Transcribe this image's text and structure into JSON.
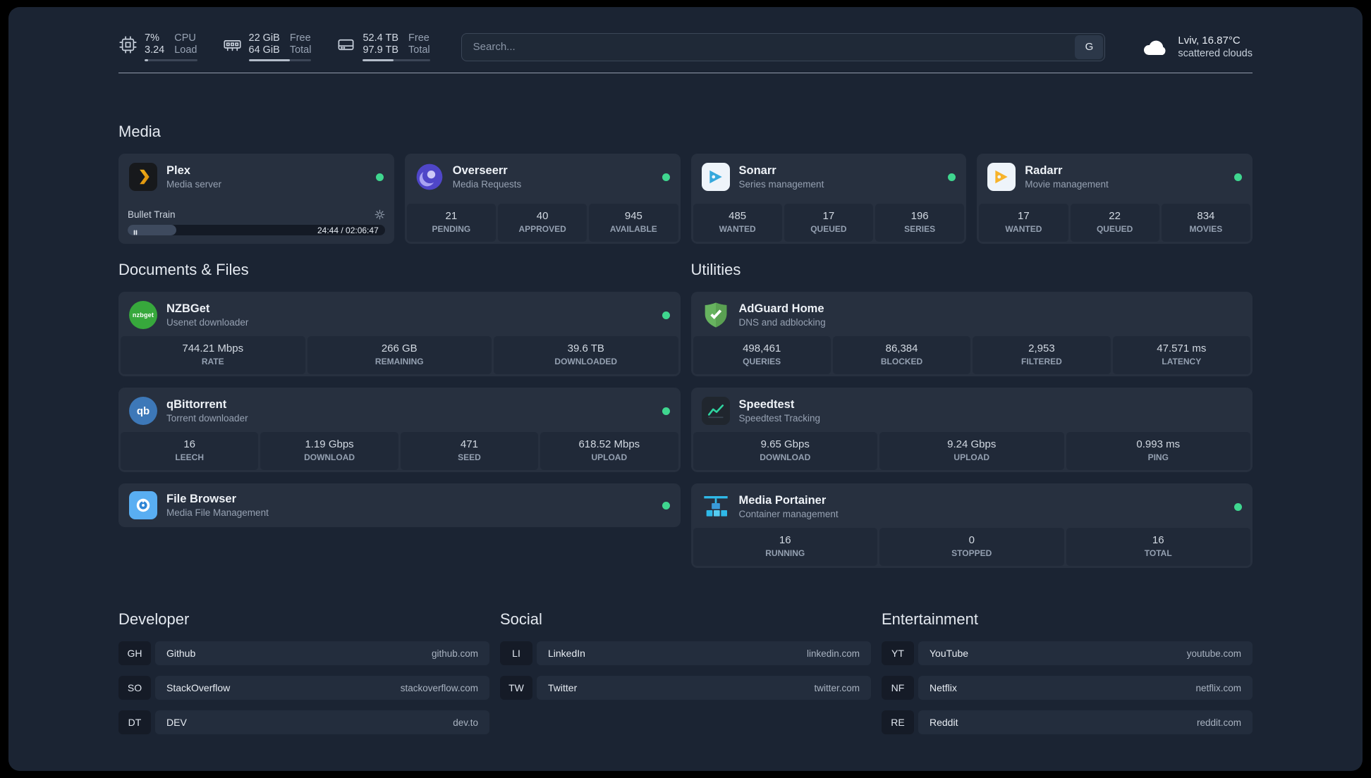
{
  "theme": {
    "bg": "#1b2433",
    "card": "#27303f",
    "stat_bg": "#202938",
    "status_online": "#3fd68f"
  },
  "topbar": {
    "resources": [
      {
        "icon": "cpu-icon",
        "rows": [
          {
            "value": "7%",
            "label": "CPU"
          },
          {
            "value": "3.24",
            "label": "Load"
          }
        ],
        "progress": 7
      },
      {
        "icon": "memory-icon",
        "rows": [
          {
            "value": "22 GiB",
            "label": "Free"
          },
          {
            "value": "64 GiB",
            "label": "Total"
          }
        ],
        "progress": 66
      },
      {
        "icon": "disk-icon",
        "rows": [
          {
            "value": "52.4 TB",
            "label": "Free"
          },
          {
            "value": "97.9 TB",
            "label": "Total"
          }
        ],
        "progress": 46
      }
    ],
    "search": {
      "placeholder": "Search...",
      "provider_button": "G"
    },
    "weather": {
      "icon": "cloud-icon",
      "location": "Lviv, 16.87°C",
      "condition": "scattered clouds"
    }
  },
  "media": {
    "title": "Media",
    "cards": [
      {
        "icon": "plex-icon",
        "title": "Plex",
        "subtitle": "Media server",
        "status": "online",
        "player": {
          "track": "Bullet Train",
          "time": "24:44 / 02:06:47",
          "progress": 19
        }
      },
      {
        "icon": "overseerr-icon",
        "title": "Overseerr",
        "subtitle": "Media Requests",
        "status": "online",
        "stats": [
          {
            "value": "21",
            "label": "PENDING"
          },
          {
            "value": "40",
            "label": "APPROVED"
          },
          {
            "value": "945",
            "label": "AVAILABLE"
          }
        ]
      },
      {
        "icon": "sonarr-icon",
        "title": "Sonarr",
        "subtitle": "Series management",
        "status": "online",
        "stats": [
          {
            "value": "485",
            "label": "WANTED"
          },
          {
            "value": "17",
            "label": "QUEUED"
          },
          {
            "value": "196",
            "label": "SERIES"
          }
        ]
      },
      {
        "icon": "radarr-icon",
        "title": "Radarr",
        "subtitle": "Movie management",
        "status": "online",
        "stats": [
          {
            "value": "17",
            "label": "WANTED"
          },
          {
            "value": "22",
            "label": "QUEUED"
          },
          {
            "value": "834",
            "label": "MOVIES"
          }
        ]
      }
    ]
  },
  "documents": {
    "title": "Documents & Files",
    "cards": [
      {
        "icon": "nzbget-icon",
        "icon_text": "nzbget",
        "title": "NZBGet",
        "subtitle": "Usenet downloader",
        "status": "online",
        "stats": [
          {
            "value": "744.21 Mbps",
            "label": "RATE"
          },
          {
            "value": "266 GB",
            "label": "REMAINING"
          },
          {
            "value": "39.6 TB",
            "label": "DOWNLOADED"
          }
        ]
      },
      {
        "icon": "qbittorrent-icon",
        "icon_text": "qb",
        "title": "qBittorrent",
        "subtitle": "Torrent downloader",
        "status": "online",
        "stats": [
          {
            "value": "16",
            "label": "LEECH"
          },
          {
            "value": "1.19 Gbps",
            "label": "DOWNLOAD"
          },
          {
            "value": "471",
            "label": "SEED"
          },
          {
            "value": "618.52 Mbps",
            "label": "UPLOAD"
          }
        ]
      },
      {
        "icon": "filebrowser-icon",
        "title": "File Browser",
        "subtitle": "Media File Management",
        "status": "online"
      }
    ]
  },
  "utilities": {
    "title": "Utilities",
    "cards": [
      {
        "icon": "adguard-icon",
        "title": "AdGuard Home",
        "subtitle": "DNS and adblocking",
        "stats": [
          {
            "value": "498,461",
            "label": "QUERIES"
          },
          {
            "value": "86,384",
            "label": "BLOCKED"
          },
          {
            "value": "2,953",
            "label": "FILTERED"
          },
          {
            "value": "47.571 ms",
            "label": "LATENCY"
          }
        ]
      },
      {
        "icon": "speedtest-icon",
        "title": "Speedtest",
        "subtitle": "Speedtest Tracking",
        "stats": [
          {
            "value": "9.65 Gbps",
            "label": "DOWNLOAD"
          },
          {
            "value": "9.24 Gbps",
            "label": "UPLOAD"
          },
          {
            "value": "0.993 ms",
            "label": "PING"
          }
        ]
      },
      {
        "icon": "portainer-icon",
        "title": "Media Portainer",
        "subtitle": "Container management",
        "status": "online",
        "stats": [
          {
            "value": "16",
            "label": "RUNNING"
          },
          {
            "value": "0",
            "label": "STOPPED"
          },
          {
            "value": "16",
            "label": "TOTAL"
          }
        ]
      }
    ]
  },
  "bookmarks": {
    "groups": [
      {
        "title": "Developer",
        "items": [
          {
            "abbr": "GH",
            "name": "Github",
            "domain": "github.com"
          },
          {
            "abbr": "SO",
            "name": "StackOverflow",
            "domain": "stackoverflow.com"
          },
          {
            "abbr": "DT",
            "name": "DEV",
            "domain": "dev.to"
          }
        ]
      },
      {
        "title": "Social",
        "items": [
          {
            "abbr": "LI",
            "name": "LinkedIn",
            "domain": "linkedin.com"
          },
          {
            "abbr": "TW",
            "name": "Twitter",
            "domain": "twitter.com"
          }
        ]
      },
      {
        "title": "Entertainment",
        "items": [
          {
            "abbr": "YT",
            "name": "YouTube",
            "domain": "youtube.com"
          },
          {
            "abbr": "NF",
            "name": "Netflix",
            "domain": "netflix.com"
          },
          {
            "abbr": "RE",
            "name": "Reddit",
            "domain": "reddit.com"
          }
        ]
      }
    ]
  }
}
